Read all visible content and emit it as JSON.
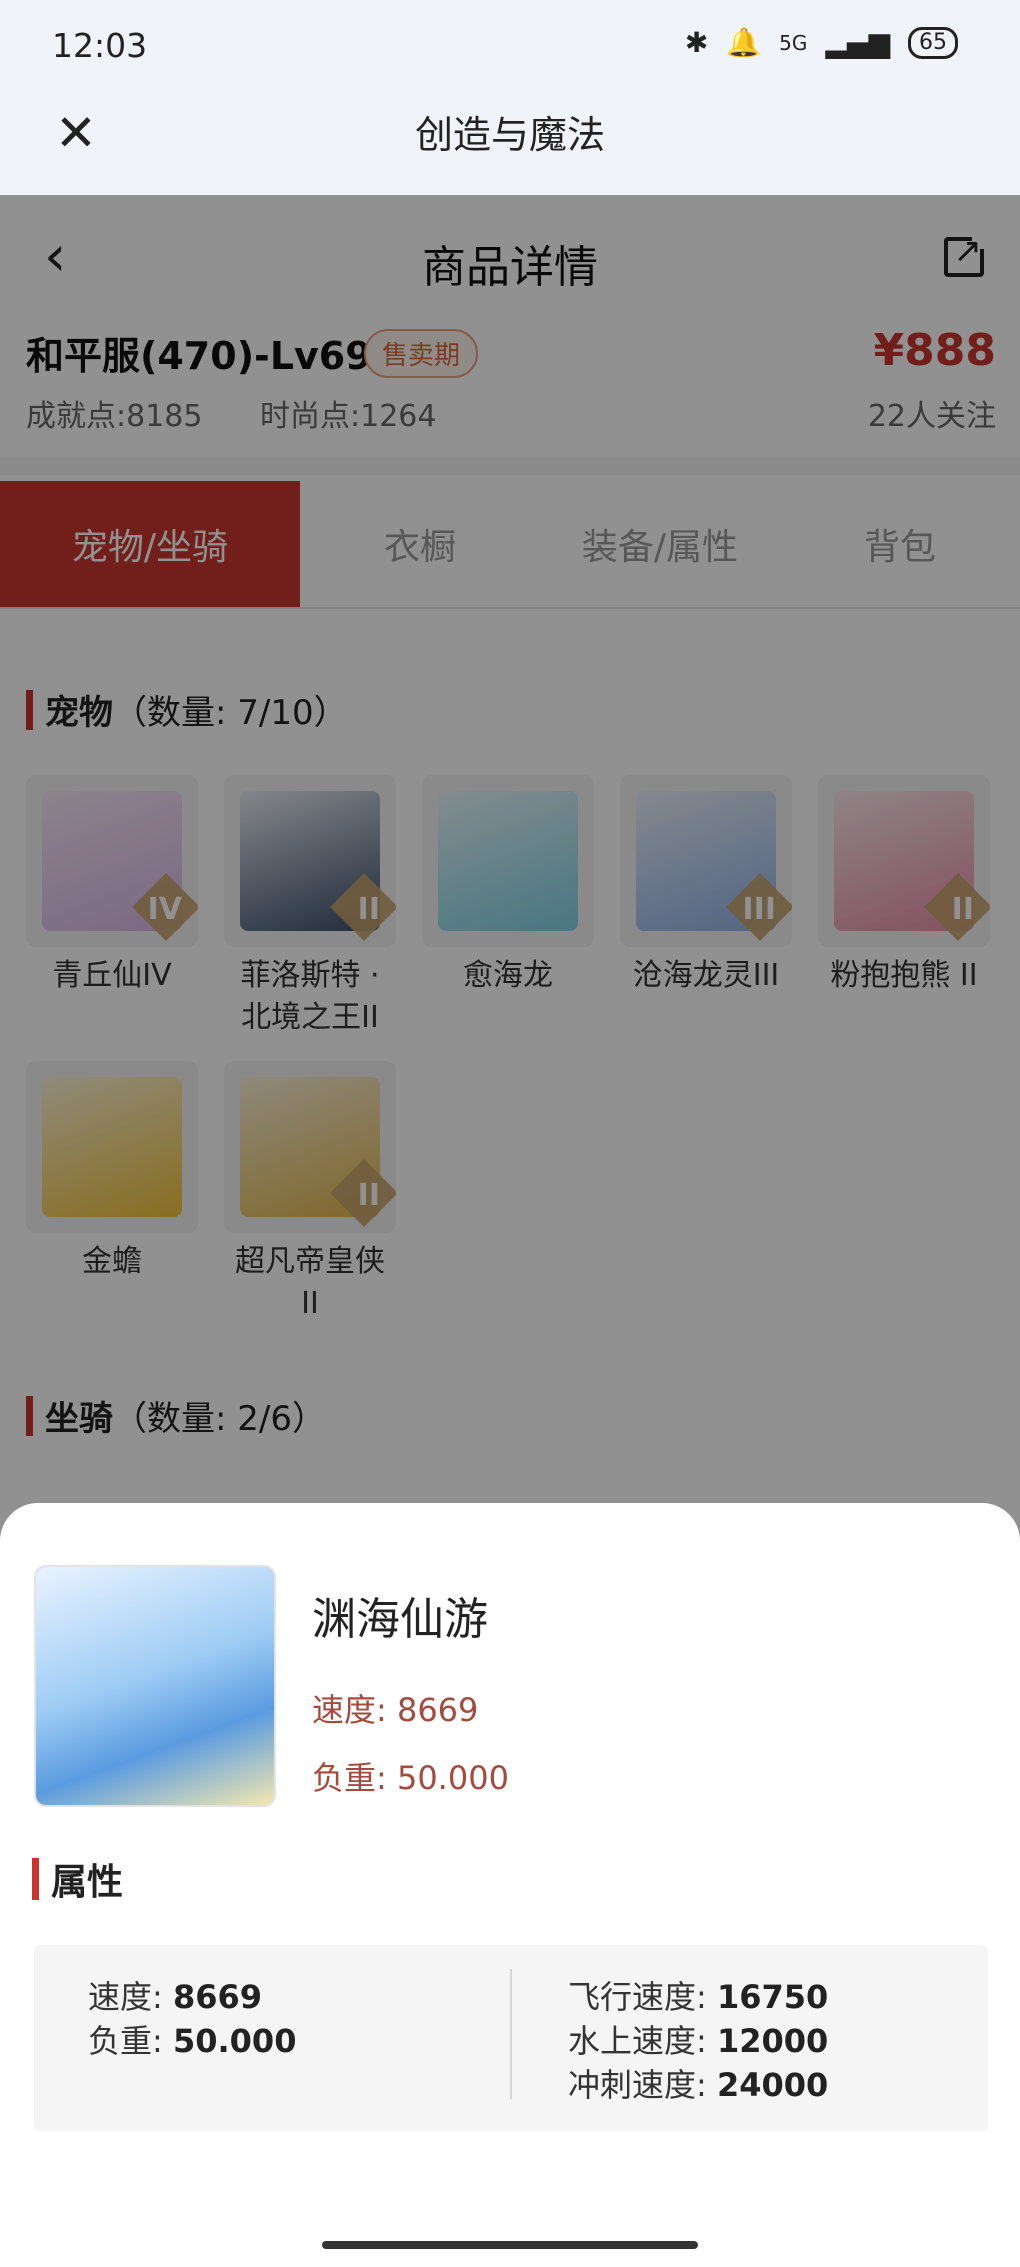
{
  "status_bar": {
    "time": "12:03",
    "network": "5G",
    "battery": "65"
  },
  "app_header": {
    "title": "创造与魔法",
    "close_icon": "close-icon"
  },
  "nav": {
    "title": "商品详情"
  },
  "product": {
    "name": "和平服(470)-Lv69",
    "badge": "售卖期",
    "price": "¥888",
    "achievement": "成就点:8185",
    "fashion": "时尚点:1264",
    "followers": "22人关注"
  },
  "tabs": [
    {
      "label": "宠物/坐骑",
      "active": true
    },
    {
      "label": "衣橱",
      "active": false
    },
    {
      "label": "装备/属性",
      "active": false
    },
    {
      "label": "背包",
      "active": false
    }
  ],
  "pets_section": {
    "title": "宠物",
    "count": "（数量: 7/10）"
  },
  "pets": [
    {
      "name": "青丘仙IV",
      "tier": "IV",
      "color": "#d9b8e6"
    },
    {
      "name": "菲洛斯特 · 北境之王II",
      "tier": "II",
      "color": "#3a4d6a"
    },
    {
      "name": "愈海龙",
      "tier": "",
      "color": "#7fd1e6"
    },
    {
      "name": "沧海龙灵III",
      "tier": "III",
      "color": "#8fb3e8"
    },
    {
      "name": "粉抱抱熊 II",
      "tier": "II",
      "color": "#e98fa8"
    },
    {
      "name": "金蟾",
      "tier": "",
      "color": "#f0c23a"
    },
    {
      "name": "超凡帝皇侠 II",
      "tier": "II",
      "color": "#e2b74c"
    }
  ],
  "mounts_section": {
    "title": "坐骑",
    "count": "（数量: 2/6）"
  },
  "sheet": {
    "mount_name": "渊海仙游",
    "speed_line": "速度: 8669",
    "load_line": "负重: 50.000",
    "attr_title": "属性",
    "left_attrs": [
      {
        "label": "速度:",
        "value": "8669"
      },
      {
        "label": "负重:",
        "value": "50.000"
      }
    ],
    "right_attrs": [
      {
        "label": "飞行速度:",
        "value": "16750"
      },
      {
        "label": "水上速度:",
        "value": "12000"
      },
      {
        "label": "冲刺速度:",
        "value": "24000"
      }
    ]
  },
  "colors": {
    "accent": "#c8362f",
    "stat_text": "#a44b3d"
  }
}
